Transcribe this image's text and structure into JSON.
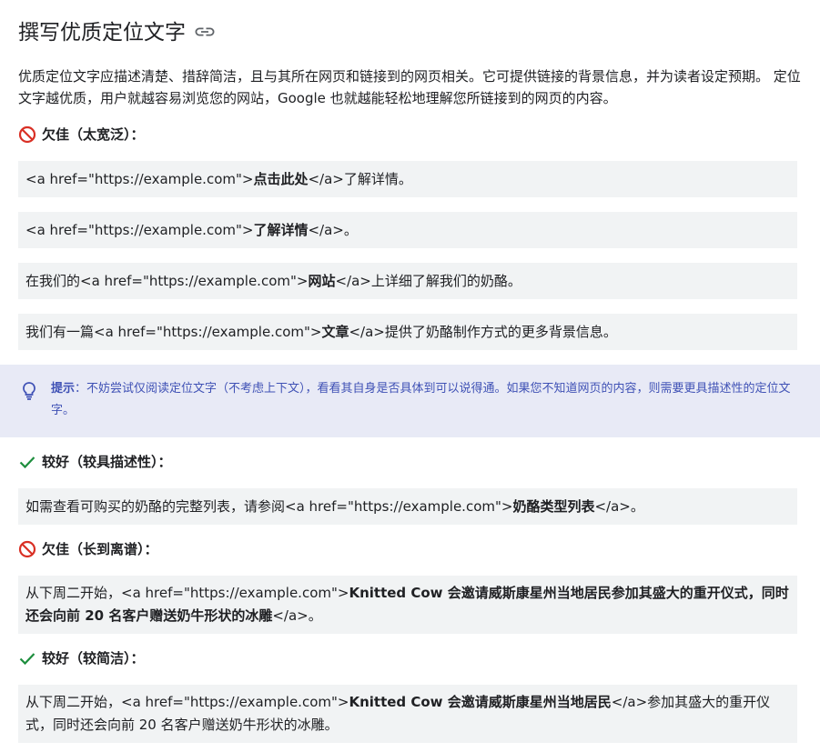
{
  "heading": {
    "title": "撰写优质定位文字"
  },
  "intro": "优质定位文字应描述清楚、措辞简洁，且与其所在网页和链接到的网页相关。它可提供链接的背景信息，并为读者设定预期。 定位文字越优质，用户就越容易浏览您的网站，Google 也就越能轻松地理解您所链接到的网页的内容。",
  "bad1": {
    "label": "欠佳（太宽泛）：",
    "examples": [
      {
        "pre": "<a href=\"https://example.com\">",
        "strong": "点击此处",
        "post": "</a>了解详情。"
      },
      {
        "pre": "<a href=\"https://example.com\">",
        "strong": "了解详情",
        "post": "</a>。"
      },
      {
        "pre": "在我们的<a href=\"https://example.com\">",
        "strong": "网站",
        "post": "</a>上详细了解我们的奶酪。"
      },
      {
        "pre": "我们有一篇<a href=\"https://example.com\">",
        "strong": "文章",
        "post": "</a>提供了奶酪制作方式的更多背景信息。"
      }
    ]
  },
  "tip": {
    "label": "提示",
    "text": "：不妨尝试仅阅读定位文字（不考虑上下文），看看其自身是否具体到可以说得通。如果您不知道网页的内容，则需要更具描述性的定位文字。"
  },
  "good1": {
    "label": "较好（较具描述性）：",
    "example": {
      "pre": "如需查看可购买的奶酪的完整列表，请参阅<a href=\"https://example.com\">",
      "strong": "奶酪类型列表",
      "post": "</a>。"
    }
  },
  "bad2": {
    "label": "欠佳（长到离谱）：",
    "example": {
      "pre": "从下周二开始，<a href=\"https://example.com\">",
      "strong": "Knitted Cow 会邀请威斯康星州当地居民参加其盛大的重开仪式，同时还会向前 20 名客户赠送奶牛形状的冰雕",
      "post": "</a>。"
    }
  },
  "good2": {
    "label": "较好（较简洁）：",
    "example": {
      "pre": "从下周二开始，<a href=\"https://example.com\">",
      "strong": "Knitted Cow 会邀请威斯康星州当地居民",
      "post": "</a>参加其盛大的重开仪式，同时还会向前 20 名客户赠送奶牛形状的冰雕。"
    }
  },
  "icons": {
    "link": "link-icon",
    "bad": "prohibited-icon",
    "good": "checkmark-icon",
    "tip": "lightbulb-icon"
  },
  "colors": {
    "bad": "#d93025",
    "good": "#1e8e3e",
    "tip_bg": "#e8eaf6",
    "tip_text": "#3f51b5",
    "code_bg": "#f1f3f4"
  }
}
